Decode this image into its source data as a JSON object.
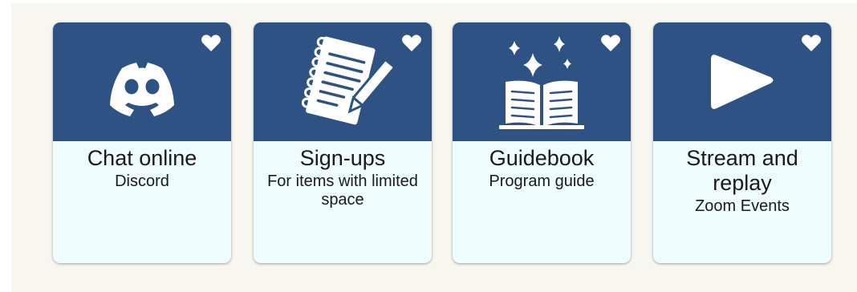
{
  "cards": [
    {
      "icon": "discord-icon",
      "title": "Chat online",
      "subtitle": "Discord"
    },
    {
      "icon": "notepad-pencil-icon",
      "title": "Sign-ups",
      "subtitle": "For items with limited space"
    },
    {
      "icon": "open-book-sparkles-icon",
      "title": "Guidebook",
      "subtitle": "Program guide"
    },
    {
      "icon": "play-icon",
      "title": "Stream and replay",
      "subtitle": "Zoom Events"
    }
  ],
  "colors": {
    "header": "#2d5283",
    "card_body": "#eefcfd",
    "page_panel": "#f8f6f0",
    "icon": "#ffffff"
  },
  "favorite_icon": "heart-icon"
}
